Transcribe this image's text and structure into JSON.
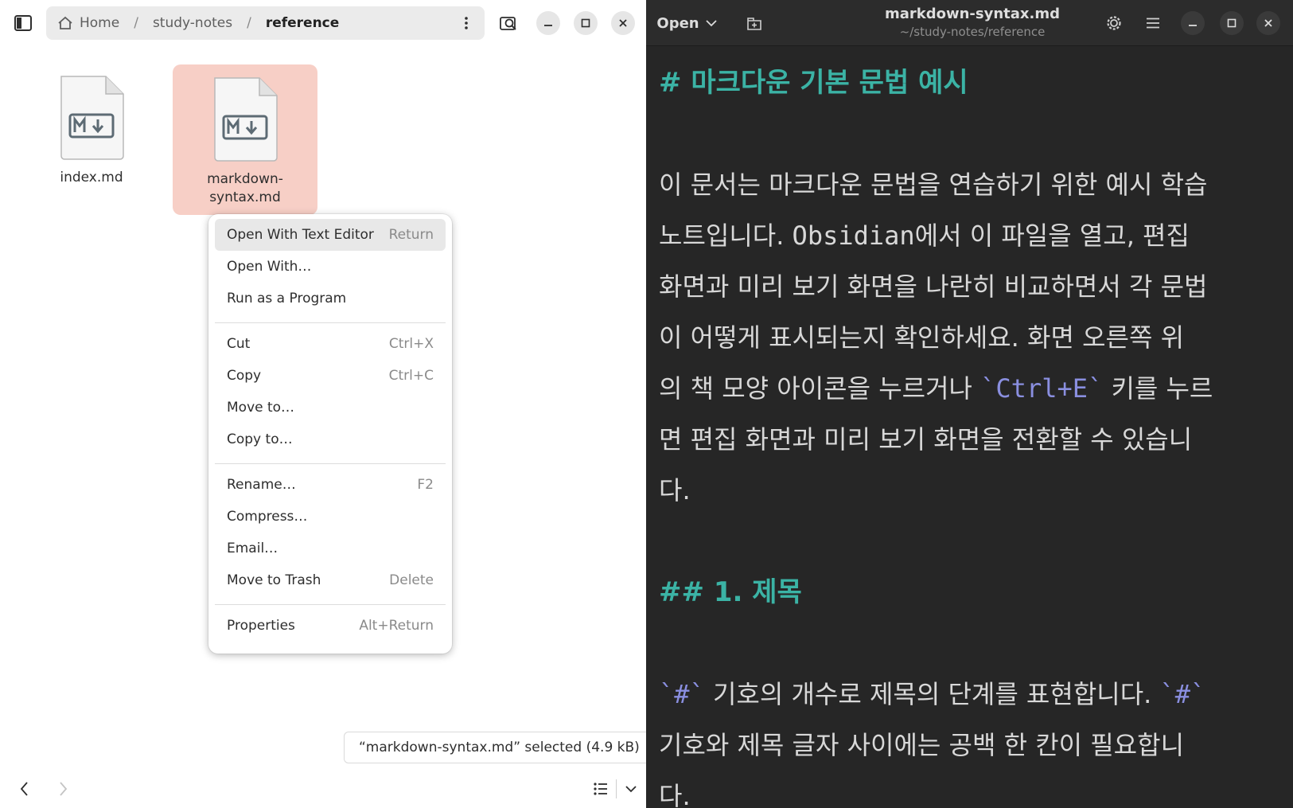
{
  "file_manager": {
    "breadcrumb": [
      "Home",
      "study-notes",
      "reference"
    ],
    "files": [
      {
        "name": "index.md",
        "selected": false
      },
      {
        "name": "markdown-syntax.md",
        "line1": "markdown-",
        "line2": "syntax.md",
        "selected": true
      }
    ],
    "context_menu": {
      "open_text_editor": {
        "label": "Open With Text Editor",
        "accel": "Return"
      },
      "open_with": {
        "label": "Open With…"
      },
      "run_program": {
        "label": "Run as a Program"
      },
      "cut": {
        "label": "Cut",
        "accel": "Ctrl+X"
      },
      "copy": {
        "label": "Copy",
        "accel": "Ctrl+C"
      },
      "move_to": {
        "label": "Move to…"
      },
      "copy_to": {
        "label": "Copy to…"
      },
      "rename": {
        "label": "Rename…",
        "accel": "F2"
      },
      "compress": {
        "label": "Compress…"
      },
      "email": {
        "label": "Email…"
      },
      "trash": {
        "label": "Move to Trash",
        "accel": "Delete"
      },
      "properties": {
        "label": "Properties",
        "accel": "Alt+Return"
      }
    },
    "status": "“markdown-syntax.md” selected  (4.9 kB)"
  },
  "editor": {
    "open_label": "Open",
    "title": "markdown-syntax.md",
    "subtitle": "~/study-notes/reference",
    "h1": "#  마크다운 기본 문법 예시",
    "para1": {
      "l1": "이 문서는 마크다운 문법을 연습하기 위한 예시 학습",
      "l2a": "노트입니다. ",
      "l2b": "Obsidian",
      "l2c": "에서 이 파일을 열고, 편집",
      "l3": "화면과 미리 보기 화면을 나란히 비교하면서 각 문법",
      "l4": "이 어떻게 표시되는지 확인하세요. 화면 오른쪽 위",
      "l5a": "의 책 모양 아이콘을 누르거나 ",
      "l5code": "`Ctrl+E`",
      "l5b": " 키를 누르",
      "l6": "면 편집 화면과 미리 보기 화면을 전환할 수 있습니",
      "l7": "다."
    },
    "h2": "##  1.  제목",
    "para2": {
      "l1code": "`#`",
      "l1a": " 기호의 개수로 제목의 단계를 표현합니다. ",
      "l1code2": "`#`",
      "l2": "기호와 제목 글자 사이에는 공백 한 칸이 필요합니",
      "l3": "다."
    }
  }
}
